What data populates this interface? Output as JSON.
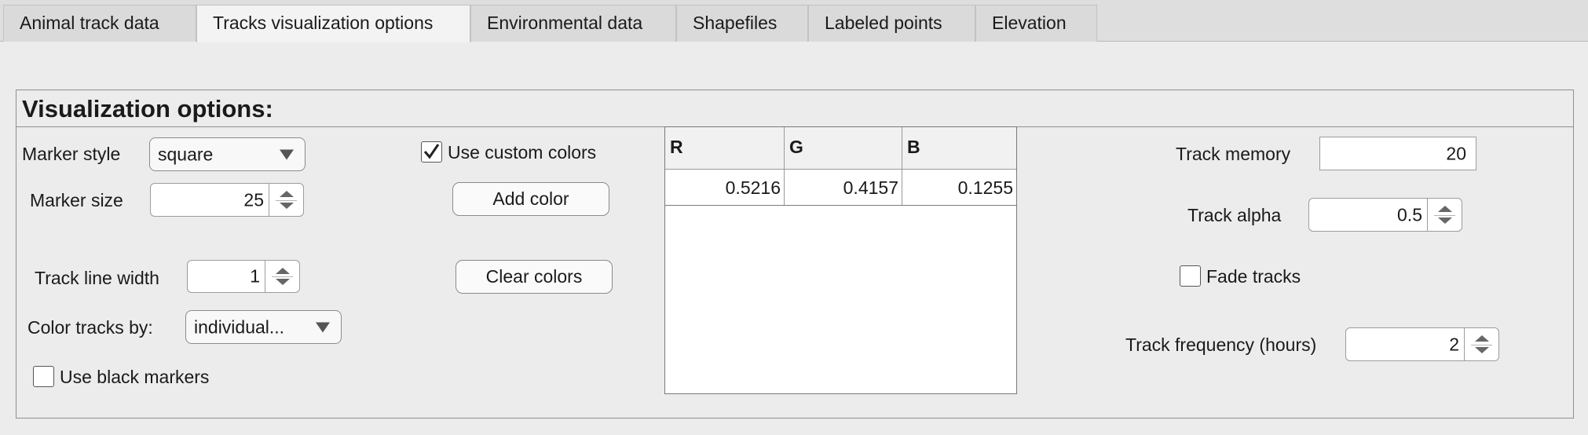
{
  "tabs": [
    {
      "label": "Animal track data"
    },
    {
      "label": "Tracks visualization options"
    },
    {
      "label": "Environmental data"
    },
    {
      "label": "Shapefiles"
    },
    {
      "label": "Labeled points"
    },
    {
      "label": "Elevation"
    }
  ],
  "active_tab": "Tracks visualization options",
  "panel": {
    "title": "Visualization options:"
  },
  "marker_style": {
    "label": "Marker style",
    "value": "square"
  },
  "marker_size": {
    "label": "Marker size",
    "value": "25"
  },
  "track_line_width": {
    "label": "Track line width",
    "value": "1"
  },
  "color_tracks_by": {
    "label": "Color tracks by:",
    "value": "individual..."
  },
  "use_black_markers": {
    "label": "Use black markers",
    "checked": false
  },
  "use_custom_colors": {
    "label": "Use custom colors",
    "checked": true
  },
  "add_color_button": {
    "label": "Add color"
  },
  "clear_colors_button": {
    "label": "Clear colors"
  },
  "color_table": {
    "columns": [
      "R",
      "G",
      "B"
    ],
    "rows": [
      [
        "0.5216",
        "0.4157",
        "0.1255"
      ]
    ]
  },
  "track_memory": {
    "label": "Track memory",
    "value": "20"
  },
  "track_alpha": {
    "label": "Track alpha",
    "value": "0.5"
  },
  "fade_tracks": {
    "label": "Fade tracks",
    "checked": false
  },
  "track_frequency": {
    "label": "Track frequency (hours)",
    "value": "2"
  }
}
